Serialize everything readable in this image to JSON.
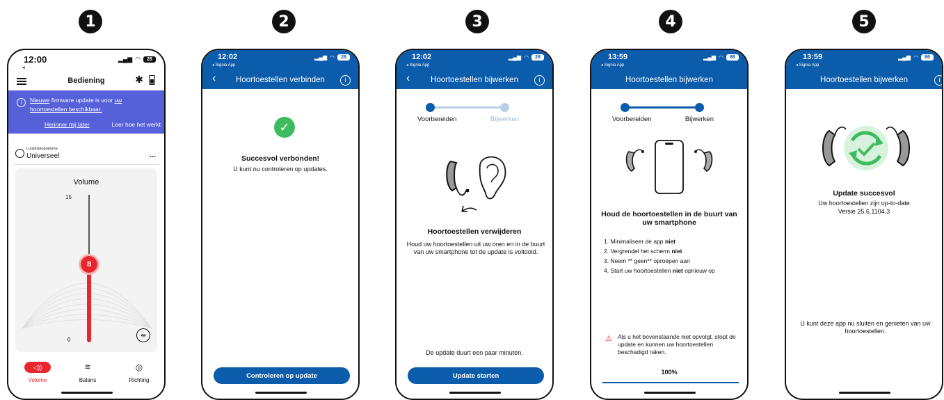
{
  "badges": [
    "1",
    "2",
    "3",
    "4",
    "5"
  ],
  "phones": {
    "p1": {
      "time": "12:00",
      "battery": "28",
      "title": "Bediening",
      "banner_text_1": "Nieuwe",
      "banner_text_2": "firmware update is voor",
      "banner_text_3": "uw hoortoestellen beschikbaar.",
      "remind": "Herinner mij later",
      "learn": "Leer hoe het werkt",
      "program_label": "Luisterprogramma",
      "program_value": "Universeel",
      "more": "...",
      "volume_title": "Volume",
      "scale_max": "15",
      "scale_min": "0",
      "volume_value": "8",
      "tabs": [
        "Volume",
        "Balans",
        "Richting"
      ]
    },
    "p2": {
      "time": "12:02",
      "back_app": "◂ Signia App",
      "battery": "28",
      "title": "Hoortoestellen verbinden",
      "success_title": "Succesvol verbonden!",
      "success_sub": "U kunt nu controleren op updates.",
      "button": "Controleren op update"
    },
    "p3": {
      "time": "12:02",
      "back_app": "◂ Signia App",
      "battery": "28",
      "title": "Hoortoestellen bijwerken",
      "step1": "Voorbereiden",
      "step2": "Bijwerken",
      "heading": "Hoortoestellen verwijderen",
      "body": "Houd uw hoortoestellen uit uw oren en in de buurt van uw smartphone tot de update is voltooid.",
      "note": "De update duurt een paar minuten.",
      "button": "Update starten"
    },
    "p4": {
      "time": "13:59",
      "back_app": "◂ Signia App",
      "battery": "86",
      "title": "Hoortoestellen bijwerken",
      "step1": "Voorbereiden",
      "step2": "Bijwerken",
      "heading": "Houd de hoortoestellen in de buurt van uw smartphone",
      "list": [
        {
          "num": "1.",
          "pre": "Minimaliseer de app ",
          "bold": "niet",
          "post": ""
        },
        {
          "num": "2.",
          "pre": "Vergrendel het scherm ",
          "bold": "niet",
          "post": ""
        },
        {
          "num": "3.",
          "pre": "Neem ** geen** oproepen aan",
          "bold": "",
          "post": ""
        },
        {
          "num": "4.",
          "pre": "Start uw hoortoestellen ",
          "bold": "niet",
          "post": " opnieuw op"
        }
      ],
      "warning": "Als u het bovenstaande niet opvolgt, stopt de update en kunnen uw hoortoestellen beschadigd raken.",
      "progress_label": "100%",
      "progress": 1.0
    },
    "p5": {
      "time": "13:59",
      "back_app": "◂ Signia App",
      "battery": "86",
      "title": "Hoortoestellen bijwerken",
      "heading": "Update succesvol",
      "line1": "Uw hoortoestellen zijn up-to-date",
      "line2": "Versie 25.6.1104.3",
      "footer": "U kunt deze app nu sluiten en genieten van uw hoortoestellen."
    }
  },
  "colors": {
    "blue": "#0b5cab",
    "red": "#e8262c",
    "purple": "#5560d9",
    "green": "#3dbb5e"
  }
}
